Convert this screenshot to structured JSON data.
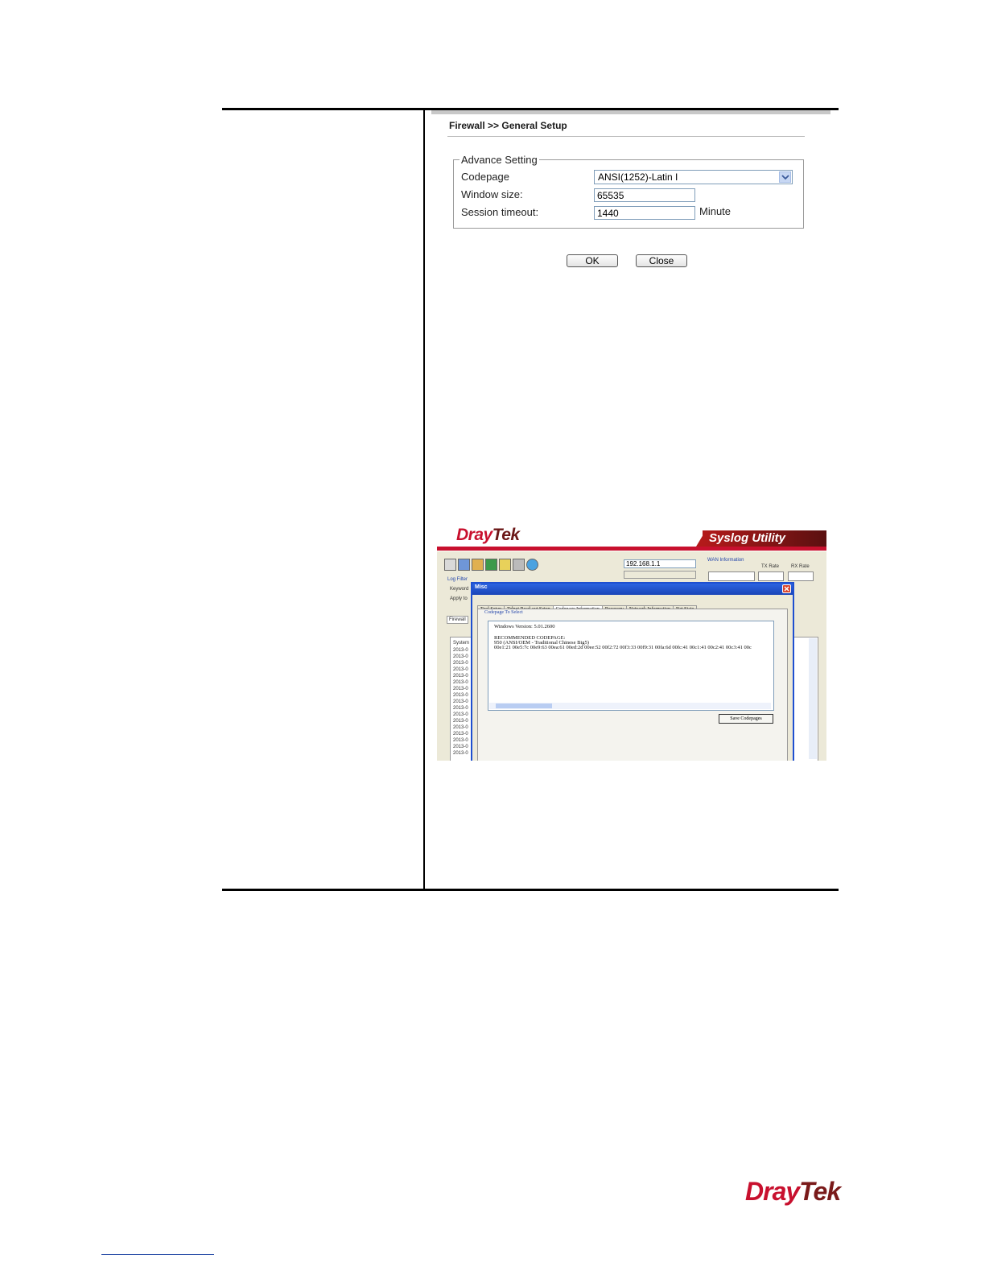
{
  "firewall": {
    "breadcrumb": "Firewall >> General Setup",
    "fieldset_legend": "Advance Setting",
    "codepage_label": "Codepage",
    "codepage_value": "ANSI(1252)-Latin I",
    "window_size_label": "Window size:",
    "window_size_value": "65535",
    "session_timeout_label": "Session timeout:",
    "session_timeout_value": "1440",
    "session_timeout_unit": "Minute",
    "ok_label": "OK",
    "close_label": "Close"
  },
  "syslog": {
    "brand_dray": "Dray",
    "brand_tek": "Tek",
    "banner": "Syslog Utility",
    "ip": "192.168.1.1",
    "wan_info_label": "WAN Information",
    "tx_rate_label": "TX Rate",
    "rx_rate_label": "RX Rate",
    "log_filter_label": "Log Filter",
    "keyword_label": "Keyword",
    "apply_label": "Apply to",
    "firewall_tab": "Firewall",
    "system_label": "System",
    "list_rows": [
      "2013-0",
      "2013-0",
      "2013-0",
      "2013-0",
      "2013-0",
      "2013-0",
      "2013-0",
      "2013-0",
      "2013-0",
      "2013-0",
      "2013-0",
      "2013-0",
      "2013-0",
      "2013-0",
      "2013-0",
      "2013-0",
      "2013-0"
    ],
    "misc": {
      "title": "Misc",
      "tabs": [
        "Tool Setup",
        "Telnet Read-out Setup",
        "Codepage Information",
        "Recovery",
        "Network Information",
        "Net State"
      ],
      "active_tab": "Codepage Information",
      "legend": "Codepage To Select",
      "windows_version": "Windows Version: 5.01.2600",
      "recommended": "RECOMMENDED CODEPAGE:",
      "codepage_line": "950   (ANSI/OEM - Traditional Chinese Big5)",
      "hex_line": "00e1:21 00e5:7c 00e9:63 00ea:61 00ed:2d 00ee:52 00f2:72 00f3:33 00f9:31 00fa:6d 00fc:41 00c1:41 00c2:41 00c3:41 00c",
      "save_button": "Save Codepages"
    }
  },
  "footer_logo": {
    "dray": "Dray",
    "tek": "Tek"
  }
}
